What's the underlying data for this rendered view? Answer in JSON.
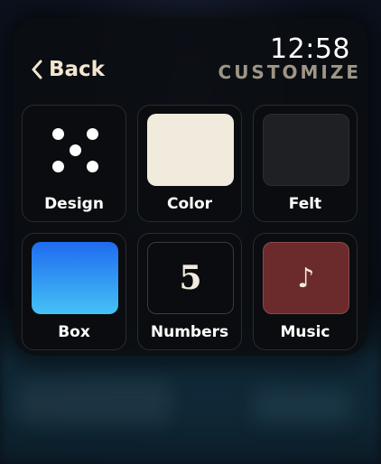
{
  "status": {
    "time": "12:58"
  },
  "header": {
    "back_label": "Back",
    "title": "CUSTOMIZE"
  },
  "tiles": [
    {
      "label": "Design",
      "icon": "dice-five-icon"
    },
    {
      "label": "Color",
      "icon": "color-swatch-icon",
      "color": "#f1ebdd"
    },
    {
      "label": "Felt",
      "icon": "felt-swatch-icon",
      "color": "#1f2024"
    },
    {
      "label": "Box",
      "icon": "box-swatch-icon",
      "color_top": "#1f6bf0",
      "color_bottom": "#45c2f5"
    },
    {
      "label": "Numbers",
      "icon": "number-icon",
      "glyph": "5"
    },
    {
      "label": "Music",
      "icon": "music-note-icon",
      "color": "#6b2a2c",
      "glyph": "♪"
    }
  ]
}
